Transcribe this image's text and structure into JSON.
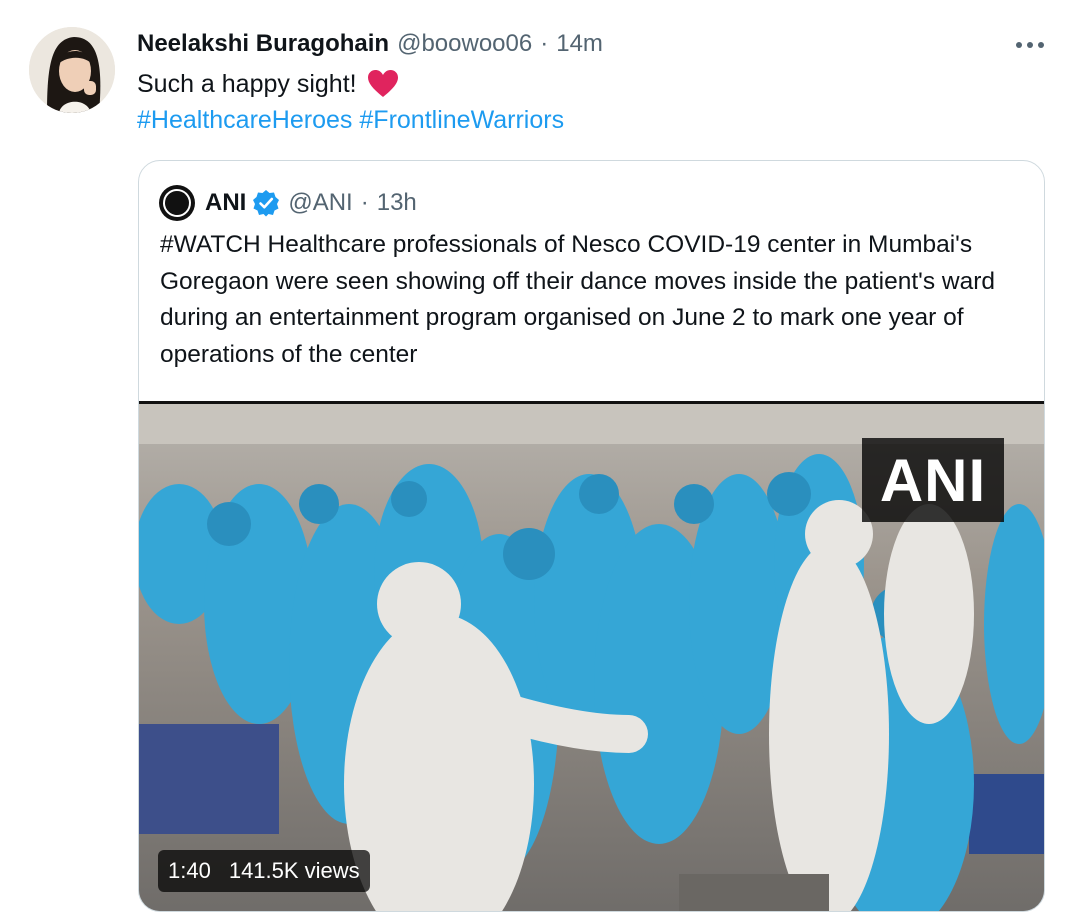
{
  "tweet": {
    "display_name": "Neelakshi Buragohain",
    "handle": "@boowoo06",
    "separator": "·",
    "time": "14m",
    "text": "Such a happy sight!",
    "emoji_icon": "red-heart",
    "hashtags": [
      "#HealthcareHeroes",
      "#FrontlineWarriors"
    ],
    "more_icon": "more-horizontal-icon"
  },
  "quoted_tweet": {
    "display_name": "ANI",
    "verified": true,
    "handle": "@ANI",
    "separator": "·",
    "time": "13h",
    "text": "#WATCH Healthcare professionals of Nesco COVID-19 center in Mumbai's Goregaon were seen showing off their dance moves inside the patient's ward during an entertainment program organised on June 2 to mark one year of operations of the center",
    "media": {
      "type": "video",
      "watermark": "ANI",
      "duration": "1:40",
      "views": "141.5K views"
    }
  },
  "colors": {
    "link": "#1d9bf0",
    "secondary_text": "#536471",
    "border": "#cfd9de",
    "verified": "#1d9bf0"
  }
}
